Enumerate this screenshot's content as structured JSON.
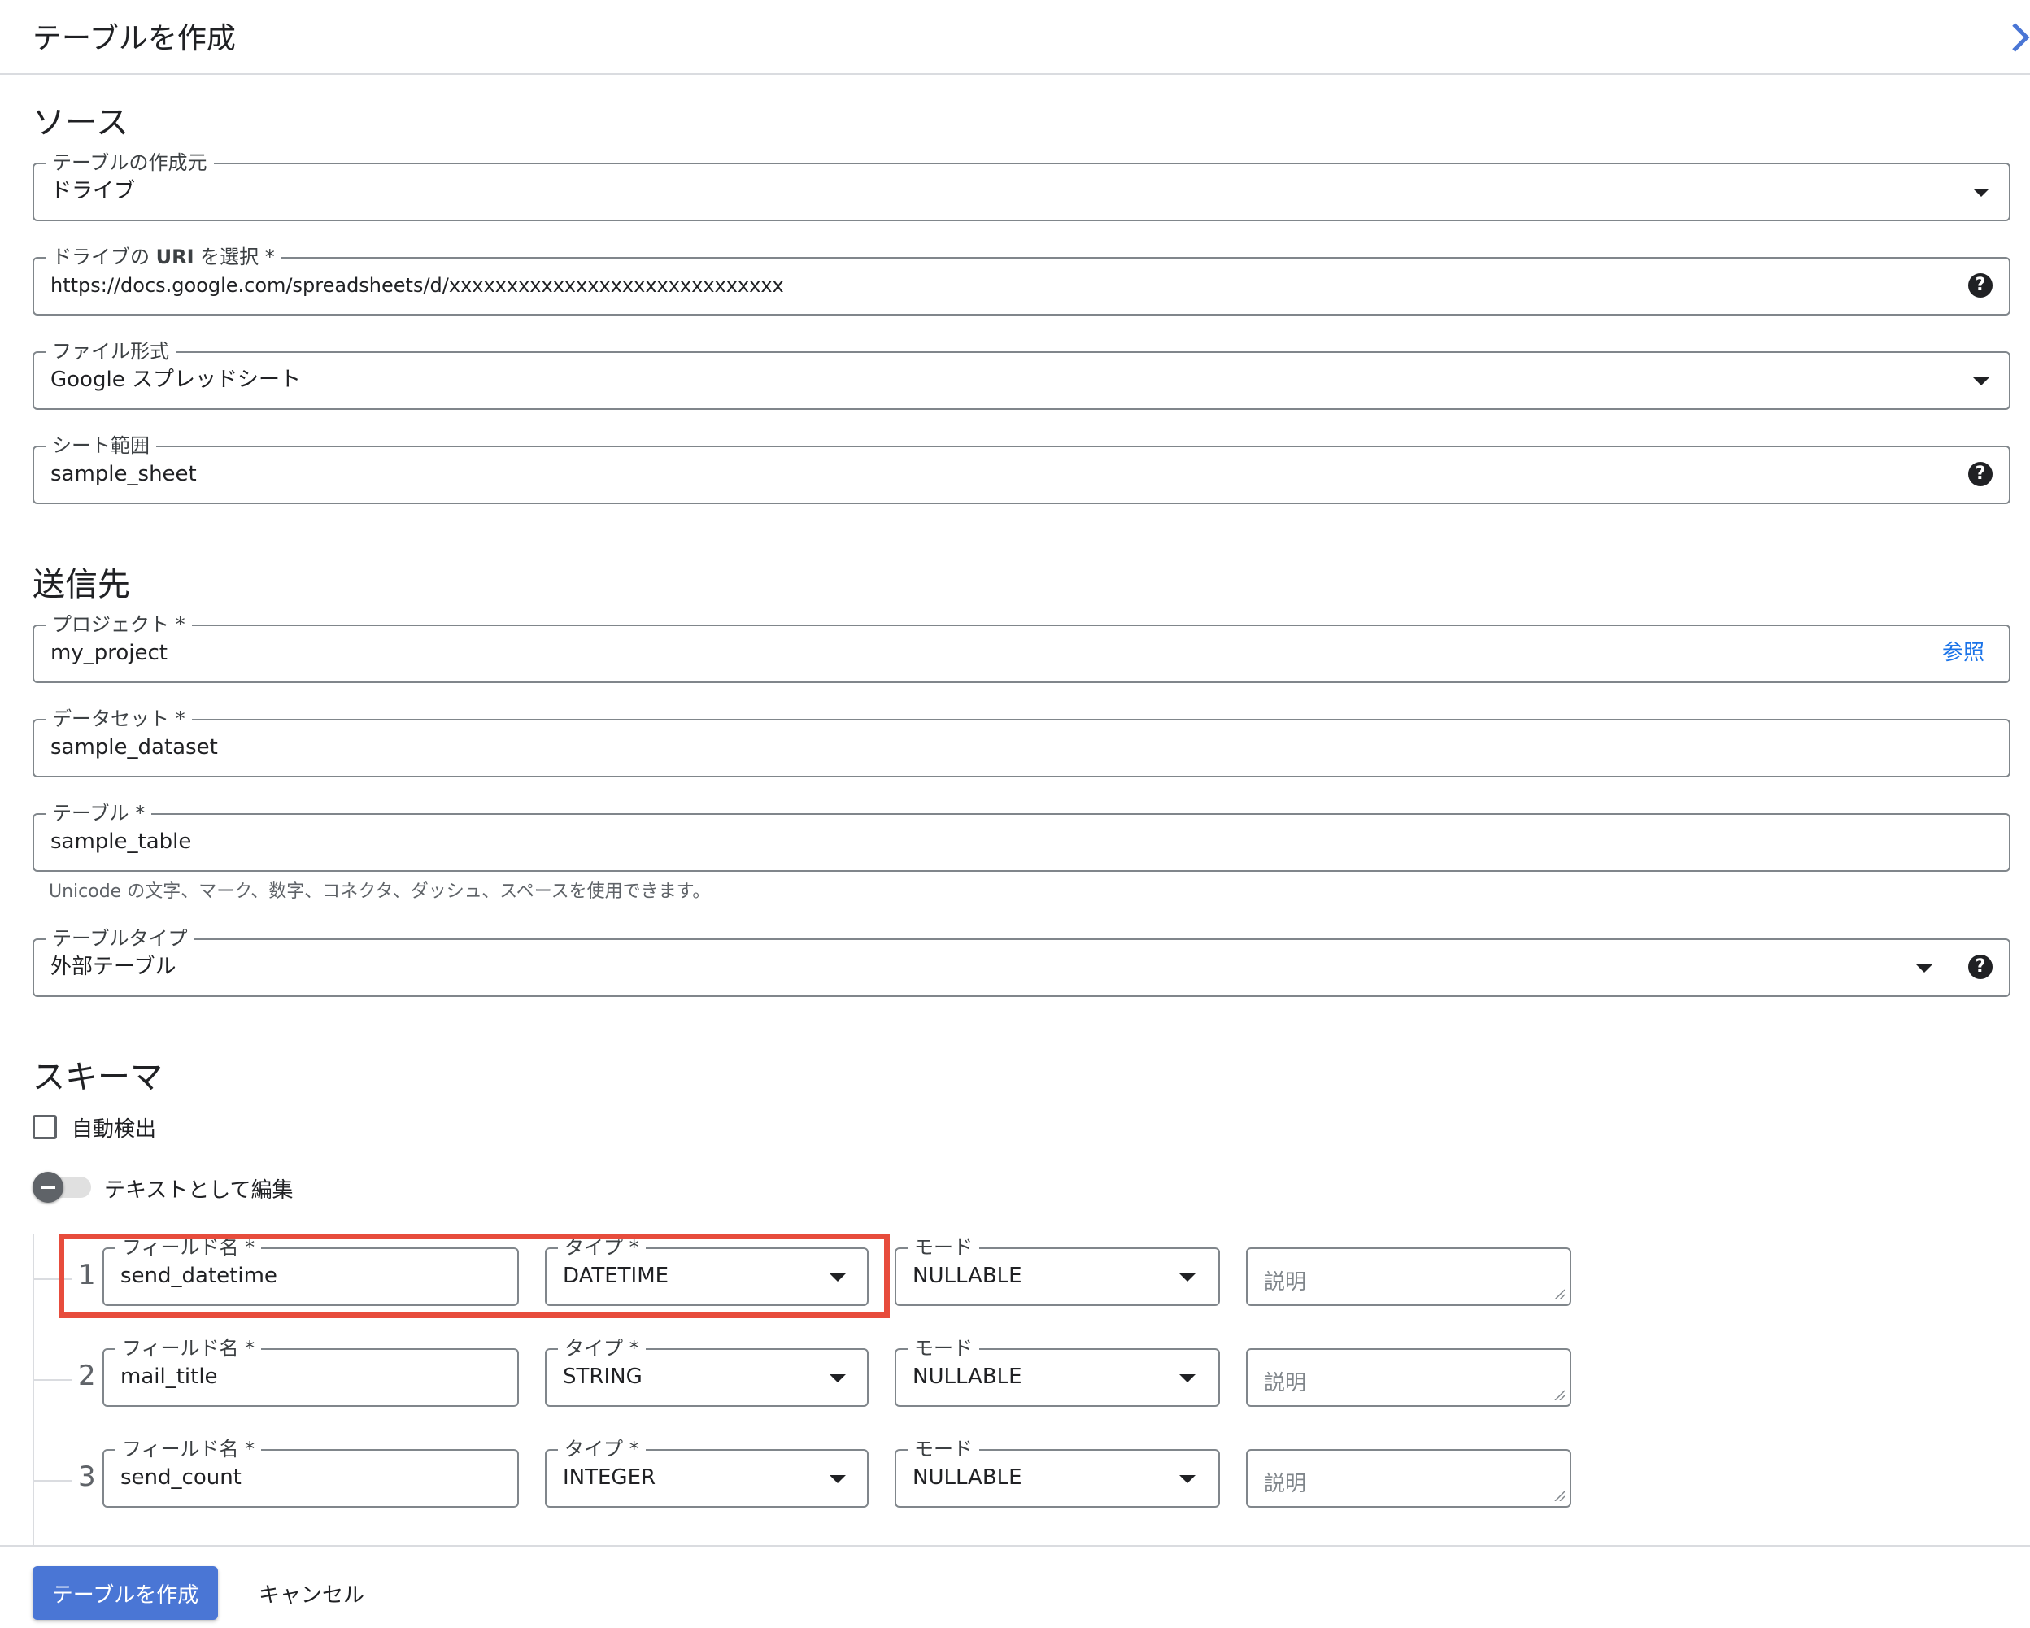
{
  "header": {
    "title": "テーブルを作成"
  },
  "source": {
    "title": "ソース",
    "create_from": {
      "label": "テーブルの作成元",
      "value": "ドライブ"
    },
    "drive_uri": {
      "label_prefix": "ドライブの ",
      "label_bold": "URI",
      "label_suffix": " を選択 *",
      "value": "https://docs.google.com/spreadsheets/d/xxxxxxxxxxxxxxxxxxxxxxxxxxxxx"
    },
    "file_format": {
      "label": "ファイル形式",
      "value": "Google スプレッドシート"
    },
    "sheet_range": {
      "label": "シート範囲",
      "value": "sample_sheet"
    }
  },
  "destination": {
    "title": "送信先",
    "project": {
      "label": "プロジェクト *",
      "value": "my_project",
      "browse": "参照"
    },
    "dataset": {
      "label": "データセット *",
      "value": "sample_dataset"
    },
    "table": {
      "label": "テーブル *",
      "value": "sample_table",
      "hint": "Unicode の文字、マーク、数字、コネクタ、ダッシュ、スペースを使用できます。"
    },
    "table_type": {
      "label": "テーブルタイプ",
      "value": "外部テーブル"
    }
  },
  "schema": {
    "title": "スキーマ",
    "auto_detect": "自動検出",
    "edit_as_text": "テキストとして編集",
    "field_name_label": "フィールド名 *",
    "type_label": "タイプ *",
    "mode_label": "モード",
    "desc_placeholder": "説明",
    "rows": [
      {
        "num": "1",
        "name": "send_datetime",
        "type": "DATETIME",
        "mode": "NULLABLE"
      },
      {
        "num": "2",
        "name": "mail_title",
        "type": "STRING",
        "mode": "NULLABLE"
      },
      {
        "num": "3",
        "name": "send_count",
        "type": "INTEGER",
        "mode": "NULLABLE"
      }
    ]
  },
  "footer": {
    "create_button": "テーブルを作成",
    "cancel_button": "キャンセル"
  },
  "colors": {
    "primary": "#4a76d5",
    "highlight": "#e74c3c",
    "link": "#1a73e8"
  },
  "icons": [
    "chevron-right-icon",
    "dropdown-arrow-icon",
    "help-icon",
    "checkbox-icon",
    "toggle-icon",
    "resize-grip-icon"
  ]
}
